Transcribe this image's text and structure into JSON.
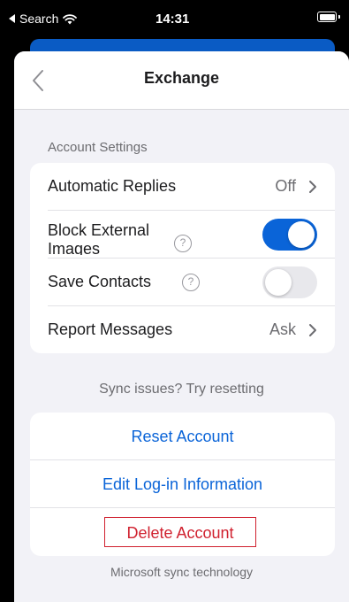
{
  "status_bar": {
    "back_label": "Search",
    "time": "14:31"
  },
  "nav": {
    "title": "Exchange"
  },
  "account_settings": {
    "header": "Account Settings",
    "automatic_replies": {
      "label": "Automatic Replies",
      "value": "Off"
    },
    "block_external_images": {
      "label": "Block External Images",
      "toggle": "on"
    },
    "save_contacts": {
      "label": "Save Contacts",
      "toggle": "off"
    },
    "report_messages": {
      "label": "Report Messages",
      "value": "Ask"
    }
  },
  "sync": {
    "note": "Sync issues? Try resetting",
    "reset_account": "Reset Account",
    "edit_login": "Edit Log-in Information",
    "delete_account": "Delete Account",
    "footer": "Microsoft sync technology"
  },
  "colors": {
    "accent": "#0a64d8",
    "danger": "#d0212f",
    "background": "#f2f2f7"
  }
}
